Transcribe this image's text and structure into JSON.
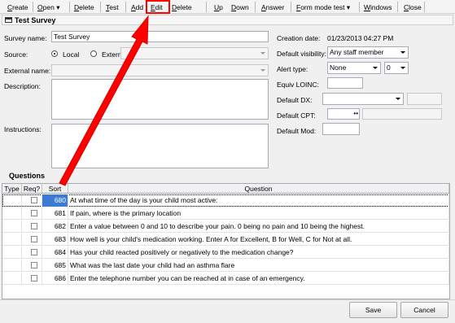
{
  "menu": {
    "items": [
      {
        "label": "Create",
        "u": "C",
        "rest": "reate"
      },
      {
        "label": "Open",
        "u": "O",
        "rest": "pen"
      },
      {
        "label": "Delete",
        "u": "D",
        "rest": "elete"
      },
      {
        "label": "Test",
        "u": "T",
        "rest": "est"
      },
      {
        "label": "Add",
        "u": "A",
        "rest": "dd"
      },
      {
        "label": "Edit",
        "u": "E",
        "rest": "dit"
      },
      {
        "label": "Delete",
        "u": "D",
        "rest": "elete"
      },
      {
        "label": "Up",
        "u": "U",
        "rest": "p"
      },
      {
        "label": "Down",
        "u": "D",
        "rest": "own"
      },
      {
        "label": "Answer",
        "u": "A",
        "rest": "nswer"
      },
      {
        "label": "Form mode test",
        "u": "F",
        "rest": "orm mode test"
      },
      {
        "label": "Windows",
        "u": "W",
        "rest": "indows"
      },
      {
        "label": "Close",
        "u": "C",
        "rest": "lose"
      }
    ],
    "dropdown_glyph": "▾"
  },
  "window": {
    "title": "Test Survey"
  },
  "form": {
    "survey_name_label": "Survey name:",
    "survey_name_value": "Test Survey",
    "source_label": "Source:",
    "source_local": "Local",
    "source_external": "External",
    "external_name_label": "External name:",
    "description_label": "Description:",
    "instructions_label": "Instructions:",
    "creation_date_label": "Creation date:",
    "creation_date_value": "01/23/2013 04:27 PM",
    "default_visibility_label": "Default visibility:",
    "default_visibility_value": "Any staff member",
    "alert_type_label": "Alert type:",
    "alert_type_value": "None",
    "alert_num_value": "0",
    "equiv_loinc_label": "Equiv LOINC:",
    "default_dx_label": "Default DX:",
    "default_cpt_label": "Default CPT:",
    "default_cpt_dots": "••",
    "default_mod_label": "Default Mod:"
  },
  "questions": {
    "section_label": "Questions",
    "headers": {
      "type": "Type",
      "req": "Req?",
      "sort": "Sort",
      "question": "Question"
    },
    "rows": [
      {
        "sort": "680",
        "question": "At what time of the day is your child most active:"
      },
      {
        "sort": "681",
        "question": "If pain, where is the primary location"
      },
      {
        "sort": "682",
        "question": "Enter a value between 0 and 10 to describe your pain.  0 being no pain and 10 being the highest."
      },
      {
        "sort": "683",
        "question": "How well is your child's medication working.  Enter A for Excellent, B for Well, C for Not at all."
      },
      {
        "sort": "684",
        "question": "Has your child reacted positively or negatively to the medication change?"
      },
      {
        "sort": "685",
        "question": "What was the last date your child had an asthma flare"
      },
      {
        "sort": "686",
        "question": "Enter the telephone number you can be reached at in case of an emergency."
      }
    ]
  },
  "footer": {
    "save_label": "Save",
    "cancel_label": "Cancel"
  },
  "colors": {
    "highlight_box": "#ff0000",
    "annotation_arrow": "#ff0000",
    "selection": "#3a7bd5"
  }
}
